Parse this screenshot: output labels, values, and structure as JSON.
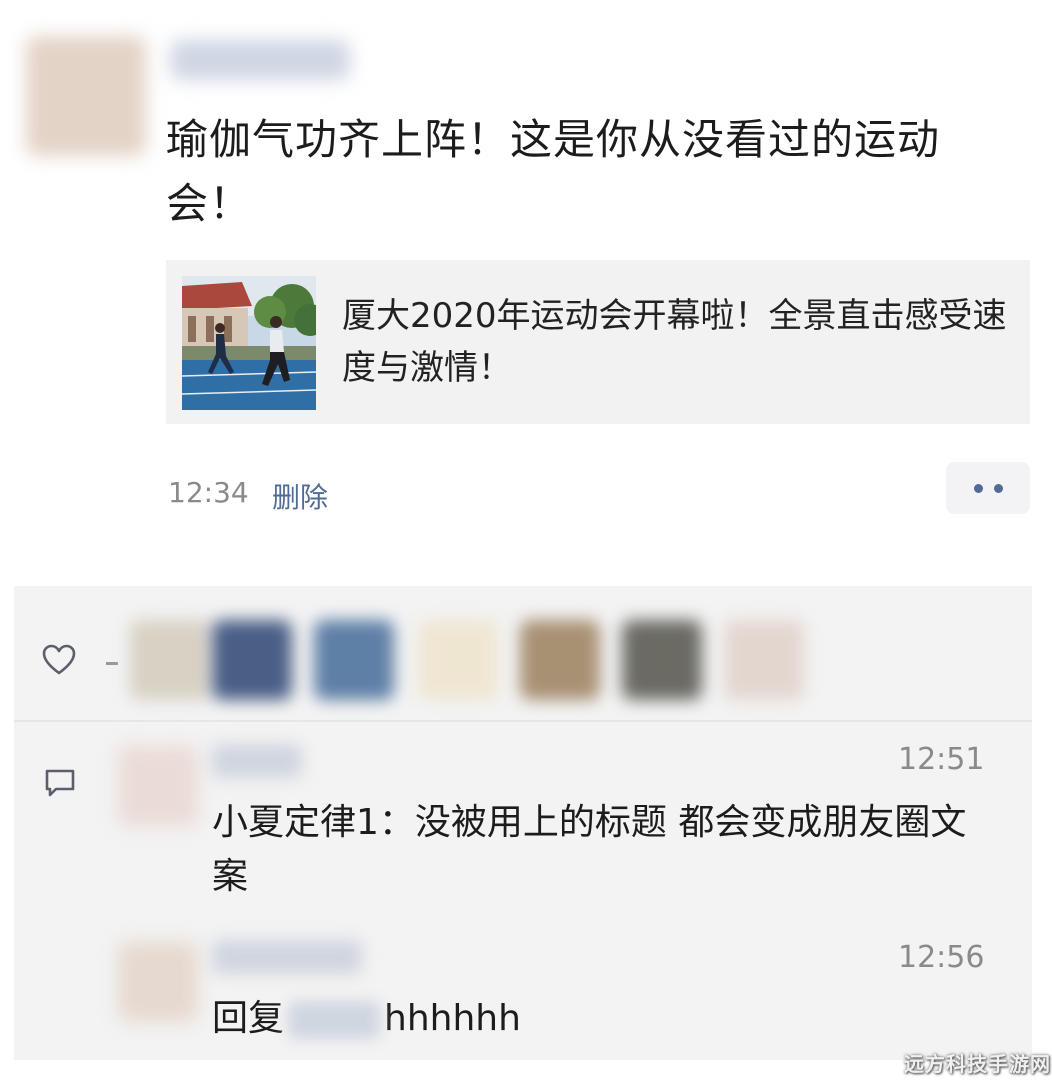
{
  "post": {
    "text": "瑜伽气功齐上阵！这是你从没看过的运动会！",
    "link_card": {
      "title": "厦大2020年运动会开幕啦！全景直击感受速度与激情！"
    },
    "time": "12:34",
    "delete_label": "删除"
  },
  "comments": [
    {
      "time": "12:51",
      "text": "小夏定律1：没被用上的标题 都会变成朋友圈文案"
    },
    {
      "time": "12:56",
      "reply_prefix": "回复",
      "text": "hhhhhh"
    }
  ],
  "watermark": "远方科技手游网",
  "colors": {
    "link_blue": "#4f6b96",
    "panel_gray": "#f3f3f3"
  }
}
